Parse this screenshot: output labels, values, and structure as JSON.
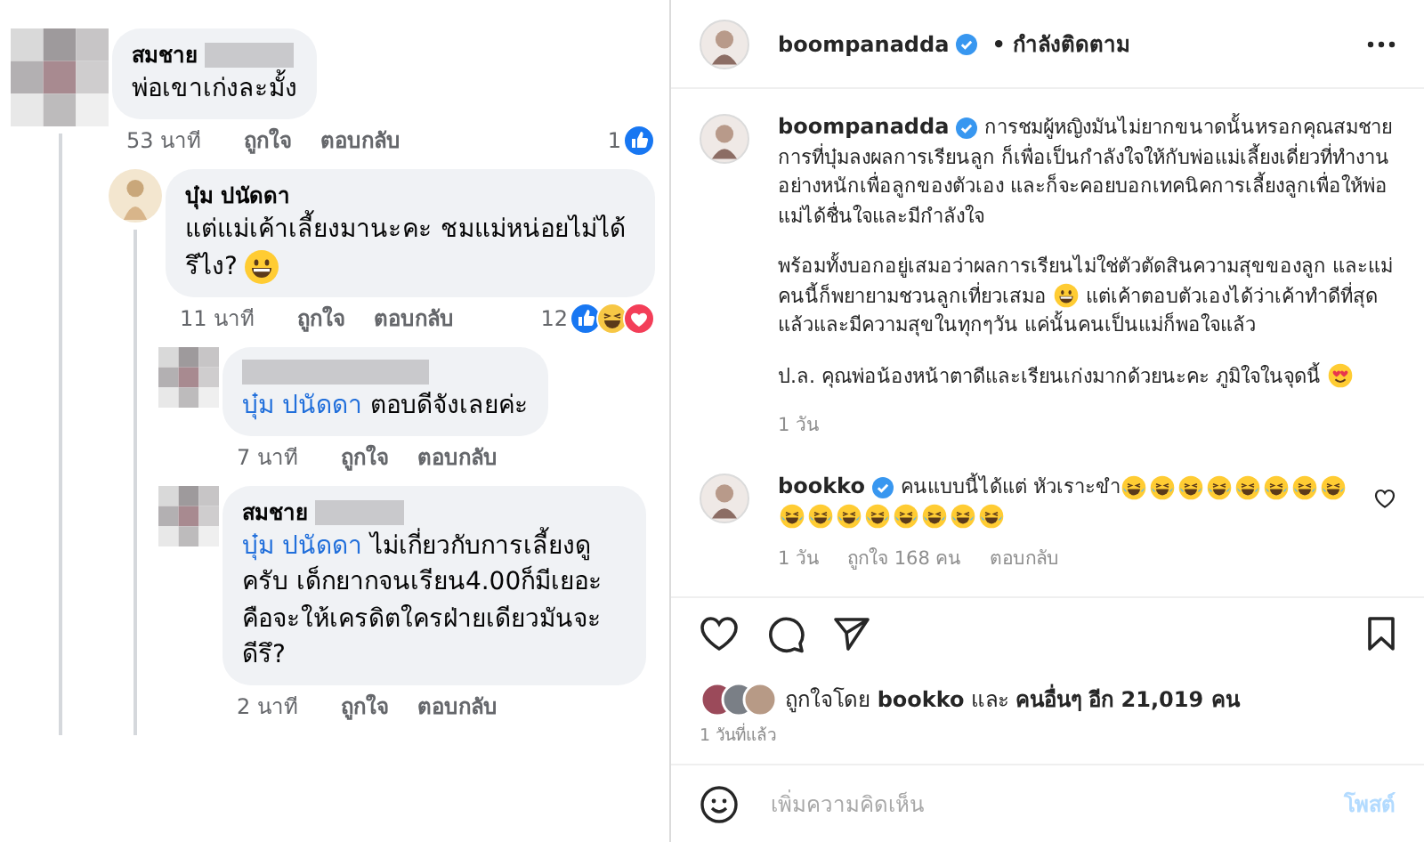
{
  "facebook_comments": [
    {
      "avatar": {
        "kind": "pixelated"
      },
      "name": "สมชาย",
      "name_redacted": true,
      "text": "พ่อเขาเก่งละมั้ง",
      "time": "53 นาที",
      "actions": [
        "ถูกใจ",
        "ตอบกลับ"
      ],
      "reaction_count": "1",
      "reactions": [
        {
          "kind": "like"
        }
      ],
      "replies": [
        {
          "avatar": {
            "kind": "photo"
          },
          "name": "บุ๋ม ปนัดดา",
          "name_redacted": false,
          "text": "แต่แม่เค้าเลี้ยงมานะคะ ชมแม่หน่อยไม่ได้รึไง?",
          "emoji": [
            {
              "kind": "grin"
            }
          ],
          "time": "11 นาที",
          "actions": [
            "ถูกใจ",
            "ตอบกลับ"
          ],
          "reaction_count": "12",
          "reactions": [
            {
              "kind": "like"
            },
            {
              "kind": "haha"
            },
            {
              "kind": "love"
            }
          ],
          "replies": [
            {
              "avatar": {
                "kind": "pixelated"
              },
              "name_redacted": true,
              "mention": "บุ๋ม ปนัดดา",
              "text": "ตอบดีจังเลยค่ะ",
              "time": "7 นาที",
              "actions": [
                "ถูกใจ",
                "ตอบกลับ"
              ]
            },
            {
              "avatar": {
                "kind": "pixelated"
              },
              "name": "สมชาย",
              "name_redacted": true,
              "mention": "บุ๋ม ปนัดดา",
              "text": "ไม่เกี่ยวกับการเลี้ยงดูครับ เด็กยากจนเรียน4.00ก็มีเยอะ คือจะให้เครดิตใครฝ่ายเดียวมันจะดีรึ?",
              "time": "2 นาที",
              "actions": [
                "ถูกใจ",
                "ตอบกลับ"
              ]
            }
          ]
        }
      ]
    }
  ],
  "instagram_post": {
    "header": {
      "username": "boompanadda",
      "verified": true,
      "separator": "•",
      "follow_status": "กำลังติดตาม"
    },
    "caption": {
      "username": "boompanadda",
      "verified": true,
      "paragraphs": [
        [
          {
            "kind": "text",
            "text": "การชมผู้หญิงมันไม่ยากขนาดนั้นหรอกคุณสมชาย การที่บุ๋มลงผลการเรียนลูก ก็เพื่อเป็นกำลังใจให้กับพ่อแม่เลี้ยงเดี่ยวที่ทำงานอย่างหนักเพื่อลูกของตัวเอง และก็จะคอยบอกเทคนิคการเลี้ยงลูกเพื่อให้พ่อแม่ได้ชื่นใจและมีกำลังใจ"
          }
        ],
        [
          {
            "kind": "text",
            "text": "พร้อมทั้งบอกอยู่เสมอว่าผลการเรียนไม่ใช่ตัวตัดสินความสุขของลูก และแม่คนนี้ก็พยายามชวนลูกเที่ยวเสมอ"
          },
          {
            "kind": "grin"
          },
          {
            "kind": "text",
            "text": "แต่เค้าตอบตัวเองได้ว่าเค้าทำดีที่สุดแล้วและมีความสุขในทุกๆวัน แค่นั้นคนเป็นแม่ก็พอใจแล้ว"
          }
        ],
        [
          {
            "kind": "text",
            "text": "ป.ล. คุณพ่อน้องหน้าตาดีและเรียนเก่งมากด้วยนะคะ ภูมิใจในจุดนี้"
          },
          {
            "kind": "heart-eyes"
          }
        ]
      ],
      "time": "1 วัน"
    },
    "comments": [
      {
        "username": "bookko",
        "verified": true,
        "text": "คนแบบนี้ได้แต่ หัวเราะขำ",
        "emoji": [
          {
            "kind": "laugh"
          },
          {
            "kind": "laugh"
          },
          {
            "kind": "laugh"
          },
          {
            "kind": "laugh"
          },
          {
            "kind": "laugh"
          },
          {
            "kind": "laugh"
          },
          {
            "kind": "laugh"
          },
          {
            "kind": "laugh"
          },
          {
            "kind": "laugh"
          },
          {
            "kind": "laugh"
          },
          {
            "kind": "laugh"
          },
          {
            "kind": "laugh"
          },
          {
            "kind": "laugh"
          },
          {
            "kind": "laugh"
          },
          {
            "kind": "laugh"
          },
          {
            "kind": "laugh"
          }
        ],
        "time": "1 วัน",
        "likes": "ถูกใจ 168 คน",
        "reply": "ตอบกลับ",
        "liked": false
      }
    ],
    "likes_text": "ถูกใจโดย **bookko** และ **คนอื่นๆ อีก 21,019 คน**",
    "posted": "1 วันที่แล้ว",
    "comment_box": {
      "placeholder": "เพิ่มความคิดเห็น",
      "post_button": "โพสต์",
      "disabled": true
    }
  }
}
